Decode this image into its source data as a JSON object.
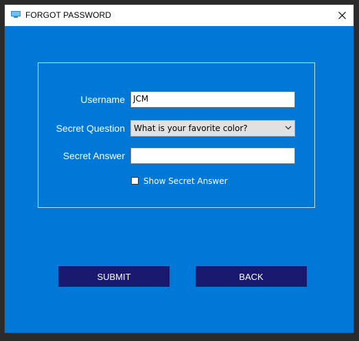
{
  "window": {
    "title": "FORGOT PASSWORD",
    "icon": "app-window-icon",
    "close_icon": "close-icon"
  },
  "form": {
    "username": {
      "label": "Username",
      "value": "JCM"
    },
    "secret_question": {
      "label": "Secret Question",
      "selected": "What is your favorite color?"
    },
    "secret_answer": {
      "label": "Secret Answer",
      "value": ""
    },
    "show_answer": {
      "label": "Show Secret Answer",
      "checked": false
    }
  },
  "buttons": {
    "submit": "SUBMIT",
    "back": "BACK"
  },
  "colors": {
    "background": "#0078d7",
    "button": "#191970",
    "titlebar": "#ffffff"
  }
}
